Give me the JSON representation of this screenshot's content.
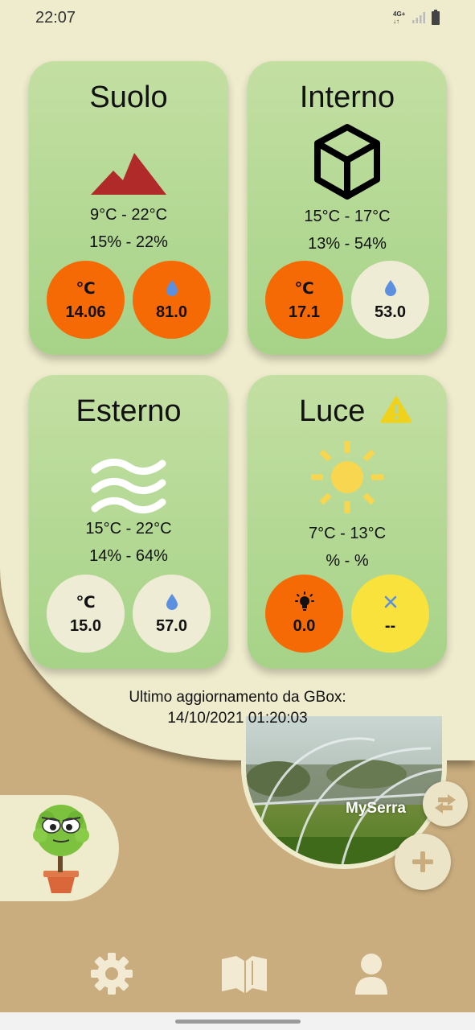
{
  "status_bar": {
    "time": "22:07",
    "network": "4G+",
    "icons": [
      "signal-icon",
      "battery-icon"
    ]
  },
  "cards": [
    {
      "id": "suolo",
      "title": "Suolo",
      "icon": "mountain-icon",
      "temp_range": "9°C - 22°C",
      "hum_range": "15% - 22%",
      "temp_label": "℃",
      "temp_value": "14.06",
      "hum_value": "81.0"
    },
    {
      "id": "interno",
      "title": "Interno",
      "icon": "cube-icon",
      "temp_range": "15°C - 17°C",
      "hum_range": "13% - 54%",
      "temp_label": "℃",
      "temp_value": "17.1",
      "hum_value": "53.0"
    },
    {
      "id": "esterno",
      "title": "Esterno",
      "icon": "wind-waves-icon",
      "temp_range": "15°C - 22°C",
      "hum_range": "14% - 64%",
      "temp_label": "℃",
      "temp_value": "15.0",
      "hum_value": "57.0"
    },
    {
      "id": "luce",
      "title": "Luce",
      "icon": "sun-icon",
      "warning_icon": "warning-icon",
      "temp_range": "7°C - 13°C",
      "hum_range": "% - %",
      "light_value": "0.0",
      "status_value": "--"
    }
  ],
  "update": {
    "line1": "Ultimo aggiornamento da GBox:",
    "line2": "14/10/2021 01:20:03"
  },
  "greenhouse": {
    "name": "MySerra"
  },
  "colors": {
    "card_green": "#b5d995",
    "bubble_orange": "#f66a06",
    "bubble_cream": "#efecd6",
    "bubble_yellow": "#f8e23b",
    "cream_bg": "#efeccd",
    "tan_bg": "#c9ad7e",
    "nav_icon": "#f2ead2"
  },
  "nav": [
    {
      "name": "settings",
      "icon": "gear-icon"
    },
    {
      "name": "guide",
      "icon": "book-icon"
    },
    {
      "name": "profile",
      "icon": "user-icon"
    }
  ]
}
